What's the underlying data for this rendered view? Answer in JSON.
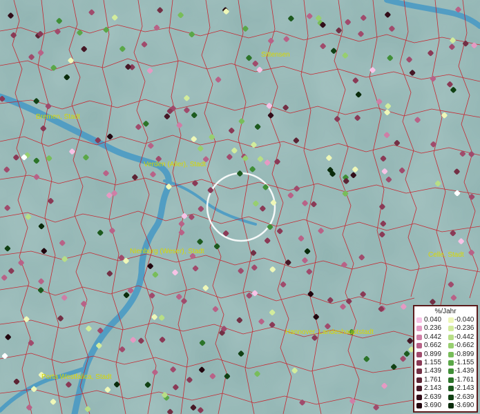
{
  "cities": [
    {
      "name": "Bremen, Stadt"
    },
    {
      "name": "Sittensen"
    },
    {
      "name": "Verden (Aller), Stadt"
    },
    {
      "name": "Nienburg (Weser), Stadt"
    },
    {
      "name": "Celle, Stadt"
    },
    {
      "name": "Hannover, Landeshauptstadt"
    },
    {
      "name": "Porta Westfalica, Stadt"
    }
  ],
  "legend": {
    "title": "%/Jahr",
    "positive": [
      "0.040",
      "0.236",
      "0.442",
      "0.662",
      "0.899",
      "1.155",
      "1.439",
      "1.761",
      "2.143",
      "2.639",
      "3.690"
    ],
    "negative": [
      "-0.040",
      "-0.236",
      "-0.442",
      "-0.662",
      "-0.899",
      "-1.155",
      "-1.439",
      "-1.761",
      "-2.143",
      "-2.639",
      "-3.690"
    ],
    "positive_colors": [
      "#f7c3e6",
      "#e59ac3",
      "#cf7ea6",
      "#b86287",
      "#a04b6c",
      "#8a3a56",
      "#733045",
      "#5c2434",
      "#461826",
      "#320d19",
      "#22070f"
    ],
    "negative_colors": [
      "#eef7b8",
      "#d2ec9c",
      "#b7de86",
      "#97cf6f",
      "#78bd5a",
      "#5aa748",
      "#408f38",
      "#2c7429",
      "#1d5a1e",
      "#114114",
      "#0a2b0b"
    ]
  },
  "colors": {
    "background": "#8fb3b1",
    "river": "#4a9ac4",
    "boundary": "#c8202a",
    "city_label": "#d8d800"
  },
  "search_circle": {
    "label": ""
  }
}
